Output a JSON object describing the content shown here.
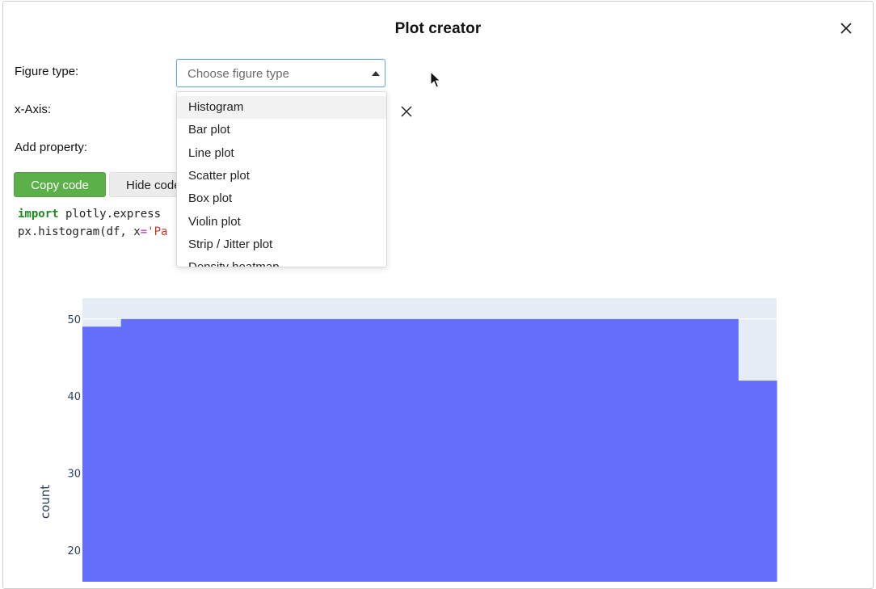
{
  "dialog": {
    "title": "Plot creator"
  },
  "form": {
    "figure_type_label": "Figure type:",
    "figure_type_placeholder": "Choose figure type",
    "x_axis_label": "x-Axis:",
    "add_property_label": "Add property:"
  },
  "buttons": {
    "copy_code": "Copy code",
    "hide_code": "Hide code"
  },
  "code": {
    "line1_kw": "import",
    "line1_rest": " plotly.express",
    "line2_start": "px.histogram(df, x",
    "line2_eq": "=",
    "line2_str": "'Pa"
  },
  "dropdown": {
    "options": [
      "Histogram",
      "Bar plot",
      "Line plot",
      "Scatter plot",
      "Box plot",
      "Violin plot",
      "Strip / Jitter plot",
      "Density heatmap"
    ],
    "highlighted": "Histogram"
  },
  "chart_data": {
    "type": "bar",
    "ylabel": "count",
    "yticks": [
      20,
      30,
      40,
      50
    ],
    "ylim": [
      20,
      52.6
    ],
    "values": [
      49,
      50,
      50,
      50,
      50,
      50,
      50,
      50,
      50,
      50,
      50,
      50,
      50,
      50,
      50,
      50,
      50,
      42
    ],
    "bar_color": "#636efa",
    "plot_bg": "#e5ecf6",
    "grid": true
  },
  "colors": {
    "accent_green": "#5cb04a",
    "focus_border": "#6fa8dc"
  }
}
